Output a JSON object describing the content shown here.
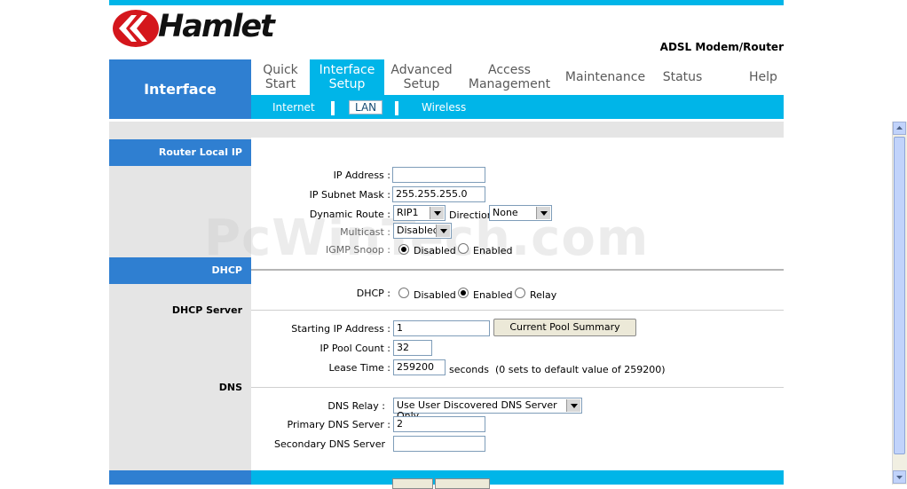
{
  "header": {
    "logo_text": "Hamlet",
    "product": "ADSL Modem/Router"
  },
  "nav": {
    "section_title": "Interface",
    "tabs": [
      {
        "label": "Quick\nStart"
      },
      {
        "label": "Interface\nSetup",
        "active": true
      },
      {
        "label": "Advanced\nSetup"
      },
      {
        "label": "Access\nManagement"
      },
      {
        "label": "Maintenance"
      },
      {
        "label": "Status"
      },
      {
        "label": "Help"
      }
    ],
    "subtabs": [
      {
        "label": "Internet"
      },
      {
        "label": "LAN",
        "active": true
      },
      {
        "label": "Wireless"
      }
    ]
  },
  "sections": {
    "router_local_ip": "Router Local IP",
    "dhcp": "DHCP",
    "dhcp_server": "DHCP Server",
    "dns": "DNS"
  },
  "form": {
    "ip_address": {
      "label": "IP Address :",
      "value": ""
    },
    "subnet_mask": {
      "label": "IP Subnet Mask :",
      "value": "255.255.255.0"
    },
    "dynamic_route": {
      "label": "Dynamic Route :",
      "value": "RIP1"
    },
    "direction": {
      "label": "Direction",
      "value": "None"
    },
    "multicast": {
      "label": "Multicast :",
      "value": "Disabled"
    },
    "igmp_snoop": {
      "label": "IGMP Snoop :",
      "option_disabled": "Disabled",
      "option_enabled": "Enabled"
    },
    "dhcp": {
      "label": "DHCP :",
      "option_disabled": "Disabled",
      "option_enabled": "Enabled",
      "option_relay": "Relay"
    },
    "starting_ip": {
      "label": "Starting IP Address :",
      "value": "1"
    },
    "pool_summary_button": "Current Pool Summary",
    "pool_count": {
      "label": "IP Pool Count :",
      "value": "32"
    },
    "lease_time": {
      "label": "Lease Time :",
      "value": "259200",
      "unit": "seconds",
      "note": "(0 sets to default value of 259200)"
    },
    "dns_relay": {
      "label": "DNS Relay :",
      "value": "Use User Discovered DNS Server Only"
    },
    "primary_dns": {
      "label": "Primary DNS Server :",
      "value": "2"
    },
    "secondary_dns": {
      "label": "Secondary DNS Server",
      "value": ""
    }
  },
  "watermark": "PcWinTech.com",
  "colors": {
    "accent": "#00b5e8",
    "brand_blue": "#2f7fd1",
    "logo_red": "#d4161c"
  }
}
